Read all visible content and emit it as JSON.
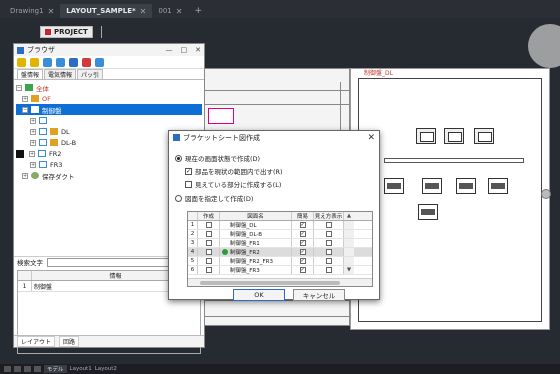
{
  "tabs": [
    {
      "label": "Drawing1"
    },
    {
      "label": "LAYOUT_SAMPLE*"
    },
    {
      "label": "001"
    }
  ],
  "project_button": {
    "label": "PROJECT"
  },
  "sheet": {
    "label": "制御盤_DL"
  },
  "browser": {
    "title": "ブラウザ",
    "tabs": [
      "盤情報",
      "電気情報",
      "パッ引"
    ],
    "tree": [
      {
        "label": "全体"
      },
      {
        "label": "OF"
      },
      {
        "label": "制御盤"
      },
      {
        "label": ""
      },
      {
        "label": "DL"
      },
      {
        "label": "DL-B"
      },
      {
        "label": "FR2"
      },
      {
        "label": "FR3"
      },
      {
        "label": "保存ダクト"
      }
    ],
    "search_label": "検索文字",
    "table": {
      "header_info": "情報",
      "row_no": "1",
      "row_value": "制御盤"
    },
    "bottom_tabs": [
      "レイアウト",
      "回路"
    ]
  },
  "dialog": {
    "title": "ブラケットシート図作成",
    "option1": "現在の画面状態で作成(D)",
    "option1_sub1": "部品を現状の範囲内で出す(R)",
    "option1_sub2": "見えている部分に作成する(L)",
    "option2": "図面を指定して作成(D)",
    "columns": {
      "make": "作成",
      "name": "図面名",
      "simple": "簡易",
      "visible": "見え方表示"
    },
    "rows": [
      {
        "no": "1",
        "name": "制御盤_DL",
        "make": false,
        "simple": true,
        "visible": false,
        "ok": false
      },
      {
        "no": "2",
        "name": "制御盤_DL-B",
        "make": false,
        "simple": true,
        "visible": false,
        "ok": false
      },
      {
        "no": "3",
        "name": "制御盤_FR1",
        "make": false,
        "simple": true,
        "visible": false,
        "ok": false
      },
      {
        "no": "4",
        "name": "制御盤_FR2",
        "make": false,
        "simple": true,
        "visible": false,
        "ok": true
      },
      {
        "no": "5",
        "name": "制御盤_FR2_FR3",
        "make": false,
        "simple": true,
        "visible": false,
        "ok": false
      },
      {
        "no": "6",
        "name": "制御盤_FR3",
        "make": false,
        "simple": true,
        "visible": false,
        "ok": false
      }
    ],
    "ok_label": "OK",
    "cancel_label": "キャンセル"
  },
  "status": {
    "model_label": "モデル",
    "layout1": "Layout1",
    "layout2": "Layout2"
  }
}
